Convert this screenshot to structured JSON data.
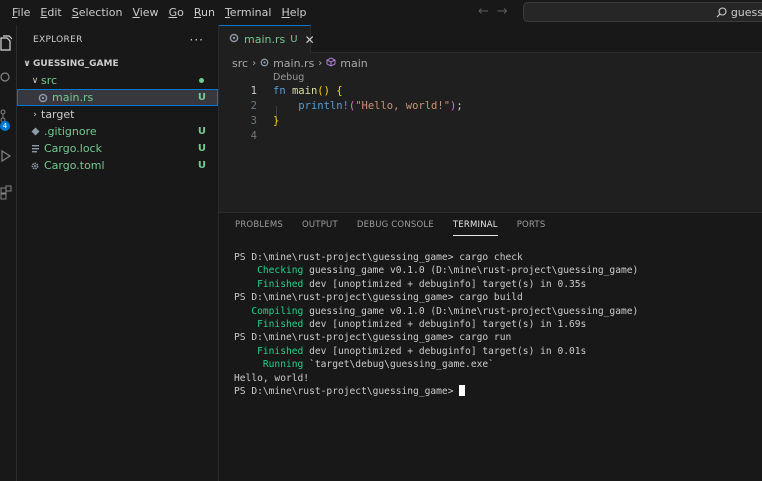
{
  "menu": [
    {
      "underline": "F",
      "rest": "ile"
    },
    {
      "underline": "E",
      "rest": "dit"
    },
    {
      "underline": "S",
      "rest": "election"
    },
    {
      "underline": "V",
      "rest": "iew"
    },
    {
      "underline": "G",
      "rest": "o"
    },
    {
      "underline": "R",
      "rest": "un"
    },
    {
      "underline": "T",
      "rest": "erminal"
    },
    {
      "underline": "H",
      "rest": "elp"
    }
  ],
  "search": {
    "text": "guess"
  },
  "activity": {
    "badge": "4"
  },
  "explorer": {
    "title": "EXPLORER",
    "more": "···",
    "project": "GUESSING_GAME",
    "items": [
      {
        "label": "src",
        "status": ""
      },
      {
        "label": "main.rs",
        "status": "U"
      },
      {
        "label": "target",
        "status": ""
      },
      {
        "label": ".gitignore",
        "status": "U"
      },
      {
        "label": "Cargo.lock",
        "status": "U"
      },
      {
        "label": "Cargo.toml",
        "status": "U"
      }
    ]
  },
  "editor": {
    "tab": {
      "label": "main.rs",
      "status": "U",
      "close": "✕"
    },
    "breadcrumb": [
      "src",
      "main.rs",
      "main"
    ],
    "codelens": "Debug",
    "line_numbers": [
      "1",
      "2",
      "3",
      "4"
    ],
    "code": {
      "l1_kw": "fn",
      "l1_name": "main",
      "l1_parens": "()",
      "l1_brace": "{",
      "l2_macro": "println!",
      "l2_open": "(",
      "l2_str": "\"Hello, world!\"",
      "l2_close": ")",
      "l2_semi": ";",
      "l3_brace": "}"
    }
  },
  "panel": {
    "tabs": [
      "PROBLEMS",
      "OUTPUT",
      "DEBUG CONSOLE",
      "TERMINAL",
      "PORTS"
    ],
    "active_tab": "TERMINAL",
    "terminal_lines": [
      {
        "kw": "",
        "text": "PS D:\\mine\\rust-project\\guessing_game> cargo check"
      },
      {
        "kw": "    Checking",
        "text": " guessing_game v0.1.0 (D:\\mine\\rust-project\\guessing_game)"
      },
      {
        "kw": "    Finished",
        "text": " dev [unoptimized + debuginfo] target(s) in 0.35s"
      },
      {
        "kw": "",
        "text": "PS D:\\mine\\rust-project\\guessing_game> cargo build"
      },
      {
        "kw": "   Compiling",
        "text": " guessing_game v0.1.0 (D:\\mine\\rust-project\\guessing_game)"
      },
      {
        "kw": "    Finished",
        "text": " dev [unoptimized + debuginfo] target(s) in 1.69s"
      },
      {
        "kw": "",
        "text": "PS D:\\mine\\rust-project\\guessing_game> cargo run"
      },
      {
        "kw": "    Finished",
        "text": " dev [unoptimized + debuginfo] target(s) in 0.01s"
      },
      {
        "kw": "     Running",
        "text": " `target\\debug\\guessing_game.exe`"
      },
      {
        "kw": "",
        "text": "Hello, world!"
      },
      {
        "kw": "",
        "text": "PS D:\\mine\\rust-project\\guessing_game> "
      }
    ]
  },
  "colors": {
    "accent": "#0078d4",
    "git_untracked": "#73c991",
    "terminal_green": "#23d18b"
  }
}
